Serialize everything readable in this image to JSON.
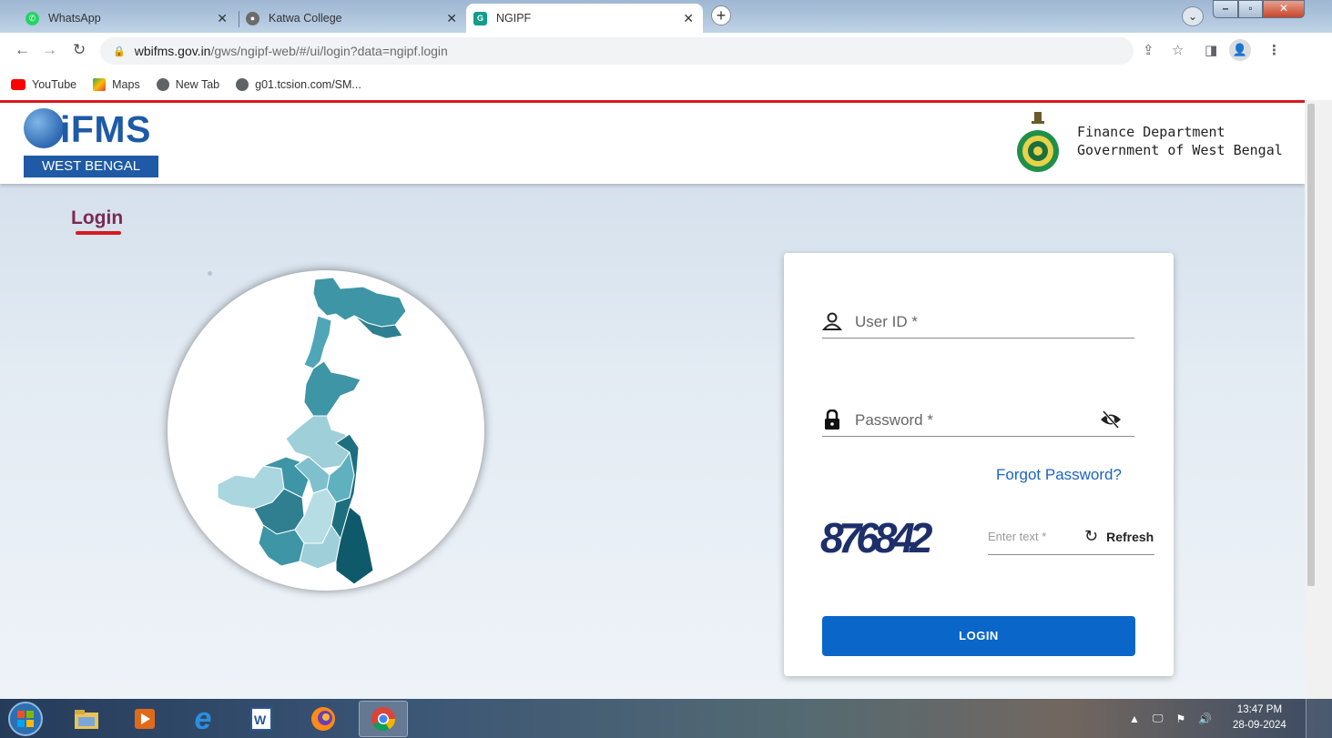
{
  "browser": {
    "tabs": [
      {
        "label": "WhatsApp",
        "icon": "whatsapp-icon"
      },
      {
        "label": "Katwa College",
        "icon": "college-logo-icon"
      },
      {
        "label": "NGIPF",
        "icon": "ngipf-icon",
        "active": true
      }
    ],
    "new_tab": "+",
    "url_domain": "wbifms.gov.in",
    "url_path": "/gws/ngipf-web/#/ui/login?data=ngipf.login",
    "bookmarks": [
      {
        "label": "YouTube",
        "icon": "youtube-icon"
      },
      {
        "label": "Maps",
        "icon": "maps-icon"
      },
      {
        "label": "New Tab",
        "icon": "globe-icon"
      },
      {
        "label": "g01.tcsion.com/SM...",
        "icon": "globe-icon"
      }
    ]
  },
  "header": {
    "logo_text": "iFMS",
    "logo_sub": "WEST BENGAL",
    "dept_line1": "Finance Department",
    "dept_line2": "Government of West Bengal"
  },
  "login": {
    "title": "Login",
    "userid_label": "User ID *",
    "password_label": "Password *",
    "forgot_label": "Forgot Password?",
    "captcha_text": "876842",
    "captcha_placeholder": "Enter text *",
    "refresh_label": "Refresh",
    "button_label": "LOGIN"
  },
  "taskbar": {
    "time": "13:47 PM",
    "date": "28-09-2024"
  },
  "colors": {
    "accent_red": "#d71920",
    "login_blue": "#0a67c9",
    "map_teal": "#3d95a6",
    "login_title": "#7b2a52"
  }
}
